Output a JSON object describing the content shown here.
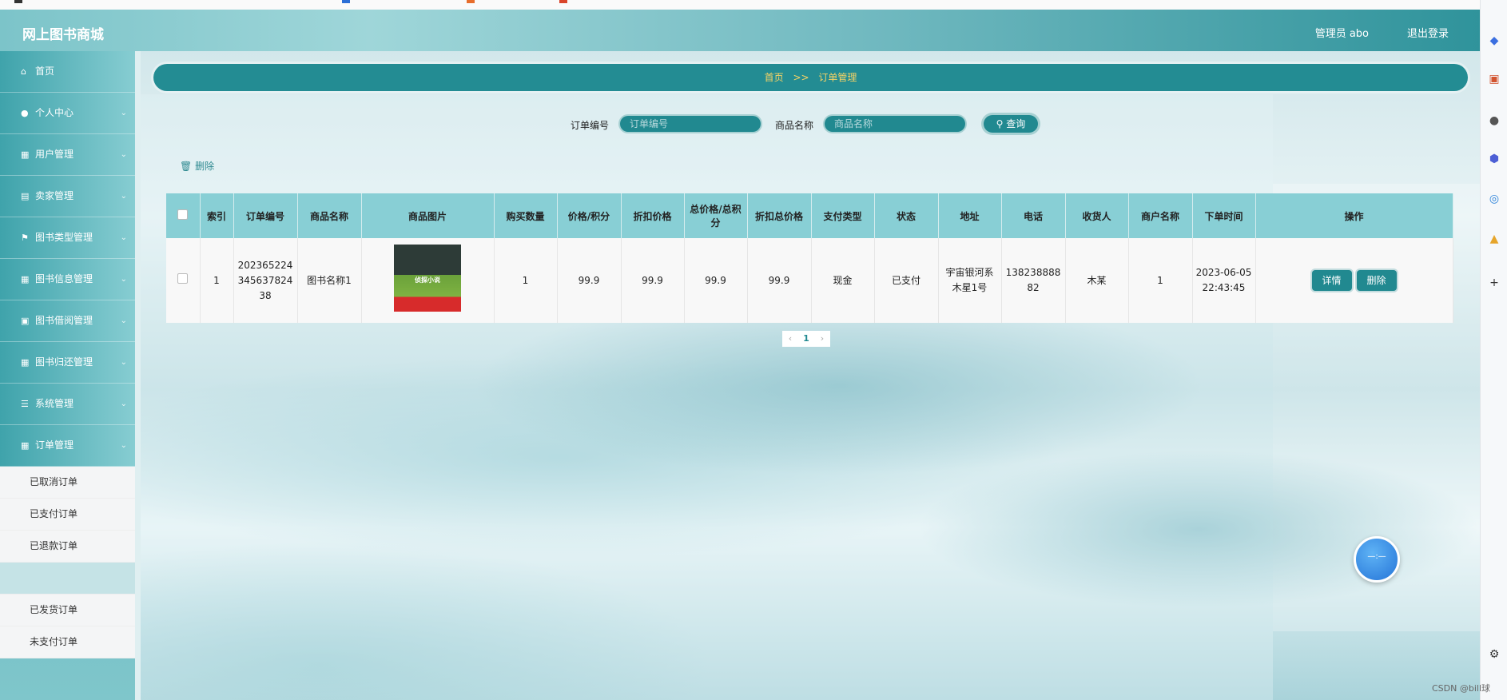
{
  "header": {
    "brand": "网上图书商城",
    "admin": "管理员 abo",
    "logout": "退出登录"
  },
  "sidebar": {
    "items": [
      {
        "label": "首页",
        "icon": "home-icon",
        "glyph": "⌂",
        "has_arrow": false
      },
      {
        "label": "个人中心",
        "icon": "user-icon",
        "glyph": "●",
        "has_arrow": true
      },
      {
        "label": "用户管理",
        "icon": "grid-icon",
        "glyph": "▦",
        "has_arrow": true
      },
      {
        "label": "卖家管理",
        "icon": "clipboard-icon",
        "glyph": "▤",
        "has_arrow": true
      },
      {
        "label": "图书类型管理",
        "icon": "flag-icon",
        "glyph": "⚑",
        "has_arrow": true
      },
      {
        "label": "图书信息管理",
        "icon": "grid-icon",
        "glyph": "▦",
        "has_arrow": true
      },
      {
        "label": "图书借阅管理",
        "icon": "archive-icon",
        "glyph": "▣",
        "has_arrow": true
      },
      {
        "label": "图书归还管理",
        "icon": "grid-icon",
        "glyph": "▦",
        "has_arrow": true
      },
      {
        "label": "系统管理",
        "icon": "sliders-icon",
        "glyph": "☰",
        "has_arrow": true
      },
      {
        "label": "订单管理",
        "icon": "grid-icon",
        "glyph": "▦",
        "has_arrow": true
      }
    ],
    "submenu": [
      "已取消订单",
      "已支付订单",
      "已退款订单",
      "",
      "已发货订单",
      "未支付订单"
    ]
  },
  "breadcrumb": {
    "home": "首页",
    "separator": ">>",
    "current": "订单管理"
  },
  "search": {
    "order_no_label": "订单编号",
    "order_no_placeholder": "订单编号",
    "product_label": "商品名称",
    "product_placeholder": "商品名称",
    "button": "查询"
  },
  "actions": {
    "delete": "删除"
  },
  "table": {
    "headers": [
      "索引",
      "订单编号",
      "商品名称",
      "商品图片",
      "购买数量",
      "价格/积分",
      "折扣价格",
      "总价格/总积分",
      "折扣总价格",
      "支付类型",
      "状态",
      "地址",
      "电话",
      "收货人",
      "商户名称",
      "下单时间",
      "操作"
    ],
    "rows": [
      {
        "index": "1",
        "order_no": "20236522434563782438",
        "product": "图书名称1",
        "book_cover_text": "侦探小说",
        "quantity": "1",
        "price": "99.9",
        "discount_price": "99.9",
        "total": "99.9",
        "discount_total": "99.9",
        "pay_type": "现金",
        "status": "已支付",
        "address": "宇宙银河系木星1号",
        "phone": "13823888882",
        "receiver": "木某",
        "merchant": "1",
        "order_time": "2023-06-05 22:43:45",
        "detail_btn": "详情",
        "delete_btn": "删除"
      }
    ]
  },
  "pagination": {
    "prev": "‹",
    "current": "1",
    "next": "›"
  },
  "watermark": "CSDN @bill球",
  "colors": {
    "primary": "#218990",
    "header_accent": "#2f939b",
    "breadcrumb_text": "#f6d365",
    "table_header": "#88cfd5"
  }
}
